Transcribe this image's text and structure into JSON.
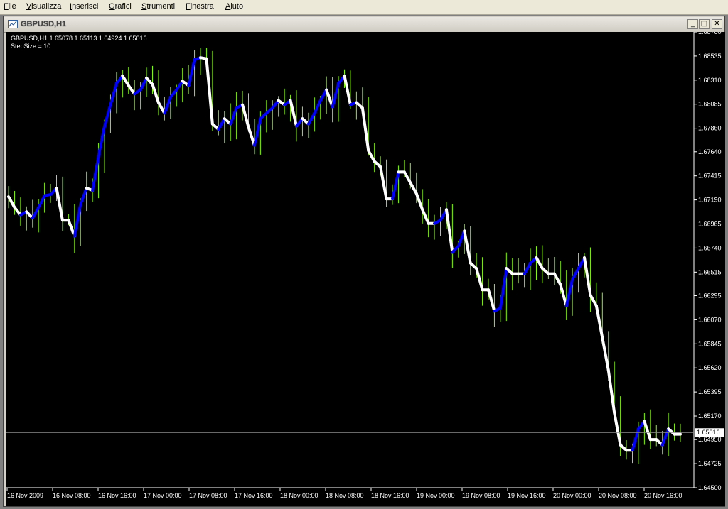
{
  "menu": [
    {
      "label": "File",
      "key": "F",
      "rest": "ile"
    },
    {
      "label": "Visualizza",
      "key": "V",
      "rest": "isualizza"
    },
    {
      "label": "Inserisci",
      "key": "I",
      "rest": "nserisci"
    },
    {
      "label": "Grafici",
      "key": "G",
      "rest": "rafici"
    },
    {
      "label": "Strumenti",
      "key": "S",
      "rest": "trumenti"
    },
    {
      "label": "Finestra",
      "key": "F",
      "rest": "inestra"
    },
    {
      "label": "Aiuto",
      "key": "A",
      "rest": "iuto"
    }
  ],
  "window": {
    "title": "GBPUSD,H1",
    "min_label": "_",
    "max_label": "□",
    "close_label": "✕"
  },
  "chart_header": {
    "symbol_line": "GBPUSD,H1  1.65078 1.65113 1.64924 1.65016",
    "indicator_line": "StepSize = 10"
  },
  "chart_data": {
    "type": "line",
    "price_axis_ticks": [
      "1.68760",
      "1.68535",
      "1.68310",
      "1.68085",
      "1.67860",
      "1.67640",
      "1.67415",
      "1.67190",
      "1.66965",
      "1.66740",
      "1.66515",
      "1.66295",
      "1.66070",
      "1.65845",
      "1.65620",
      "1.65395",
      "1.65170",
      "1.64950",
      "1.64725",
      "1.64500"
    ],
    "current_price": "1.65016",
    "ylim": [
      1.645,
      1.6876
    ],
    "time_axis_ticks": [
      "16 Nov 2009",
      "16 Nov 08:00",
      "16 Nov 16:00",
      "17 Nov 00:00",
      "17 Nov 08:00",
      "17 Nov 16:00",
      "18 Nov 00:00",
      "18 Nov 08:00",
      "18 Nov 16:00",
      "19 Nov 00:00",
      "19 Nov 08:00",
      "19 Nov 16:00",
      "20 Nov 00:00",
      "20 Nov 08:00",
      "20 Nov 16:00"
    ],
    "series": [
      {
        "kind": "price",
        "values": [
          1.6722,
          1.6712,
          1.6705,
          1.6708,
          1.6702,
          1.6712,
          1.6723,
          1.6724,
          1.673,
          1.67,
          1.67,
          1.6685,
          1.6715,
          1.673,
          1.6728,
          1.676,
          1.6788,
          1.6808,
          1.6828,
          1.6835,
          1.6826,
          1.6818,
          1.6822,
          1.6833,
          1.6827,
          1.681,
          1.68,
          1.6815,
          1.6822,
          1.683,
          1.6826,
          1.685,
          1.6852,
          1.6851,
          1.679,
          1.6785,
          1.6795,
          1.679,
          1.6805,
          1.6808,
          1.6787,
          1.677,
          1.6795,
          1.68,
          1.6805,
          1.6812,
          1.6808,
          1.6812,
          1.6788,
          1.6795,
          1.679,
          1.68,
          1.6812,
          1.6822,
          1.6806,
          1.6828,
          1.6835,
          1.6808,
          1.681,
          1.6805,
          1.6765,
          1.6755,
          1.675,
          1.672,
          1.672,
          1.6745,
          1.6745,
          1.6735,
          1.6725,
          1.671,
          1.6697,
          1.6697,
          1.67,
          1.671,
          1.667,
          1.6676,
          1.669,
          1.666,
          1.6655,
          1.6635,
          1.6635,
          1.6615,
          1.6618,
          1.6655,
          1.665,
          1.665,
          1.665,
          1.666,
          1.6665,
          1.6655,
          1.665,
          1.665,
          1.664,
          1.662,
          1.6645,
          1.6655,
          1.6665,
          1.663,
          1.662,
          1.659,
          1.656,
          1.652,
          1.649,
          1.6485,
          1.6485,
          1.6505,
          1.6512,
          1.6495,
          1.6495,
          1.649,
          1.6505,
          1.65,
          1.65
        ]
      },
      {
        "kind": "step_indicator",
        "up_color": "#0000ff",
        "down_color": "#ffffff"
      }
    ],
    "colors": {
      "background": "#000000",
      "axis_text": "#ffffff",
      "candle": "#7cfc00",
      "bid_line": "#8c8c8c"
    }
  }
}
